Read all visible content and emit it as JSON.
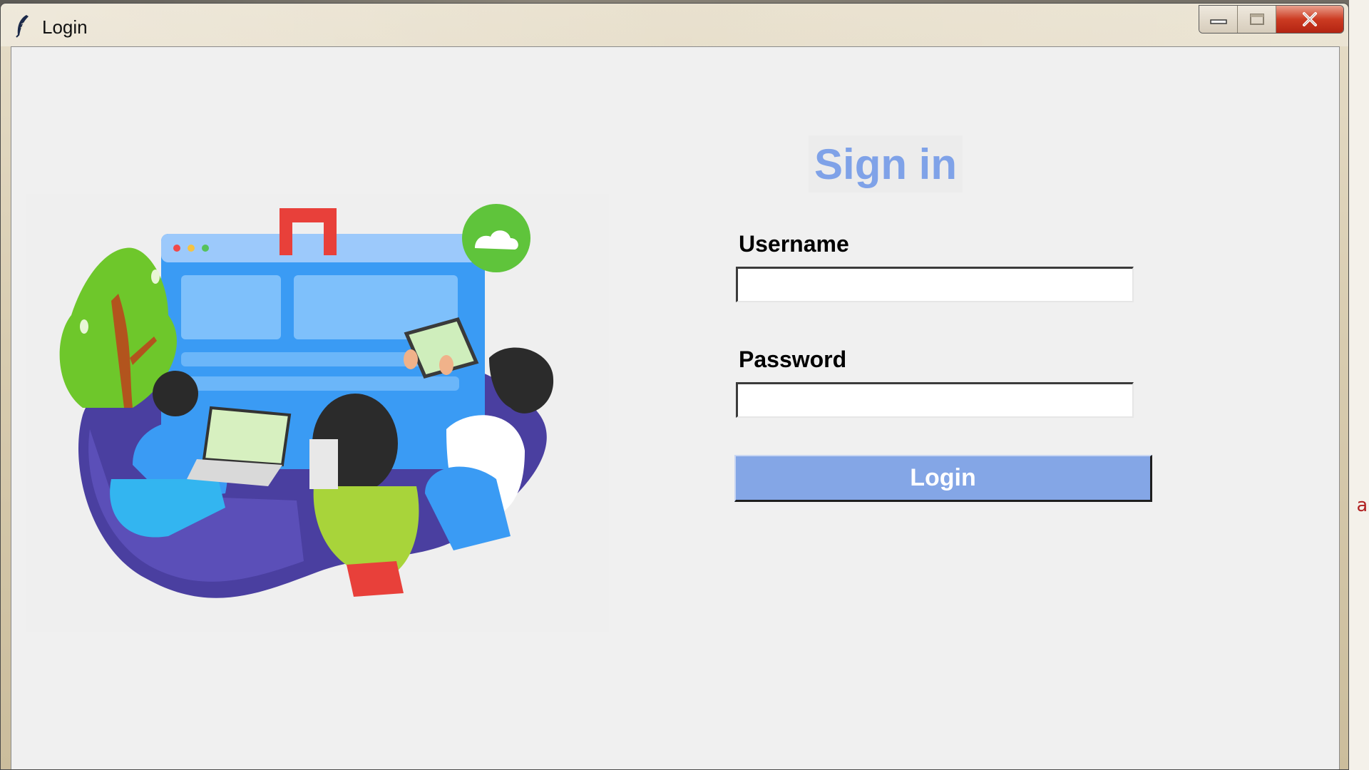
{
  "window": {
    "title": "Login",
    "controls": {
      "minimize_icon": "minimize-icon",
      "maximize_icon": "maximize-icon",
      "close_icon": "close-icon"
    }
  },
  "form": {
    "heading": "Sign in",
    "username_label": "Username",
    "username_value": "",
    "password_label": "Password",
    "password_value": "",
    "login_button": "Login"
  },
  "background": {
    "edge_glyph": "a"
  },
  "colors": {
    "heading": "#7fa2e8",
    "button": "#84a6e6",
    "client_bg": "#f0f0f0"
  },
  "illustration": {
    "icon": "team-collaboration-illustration"
  }
}
